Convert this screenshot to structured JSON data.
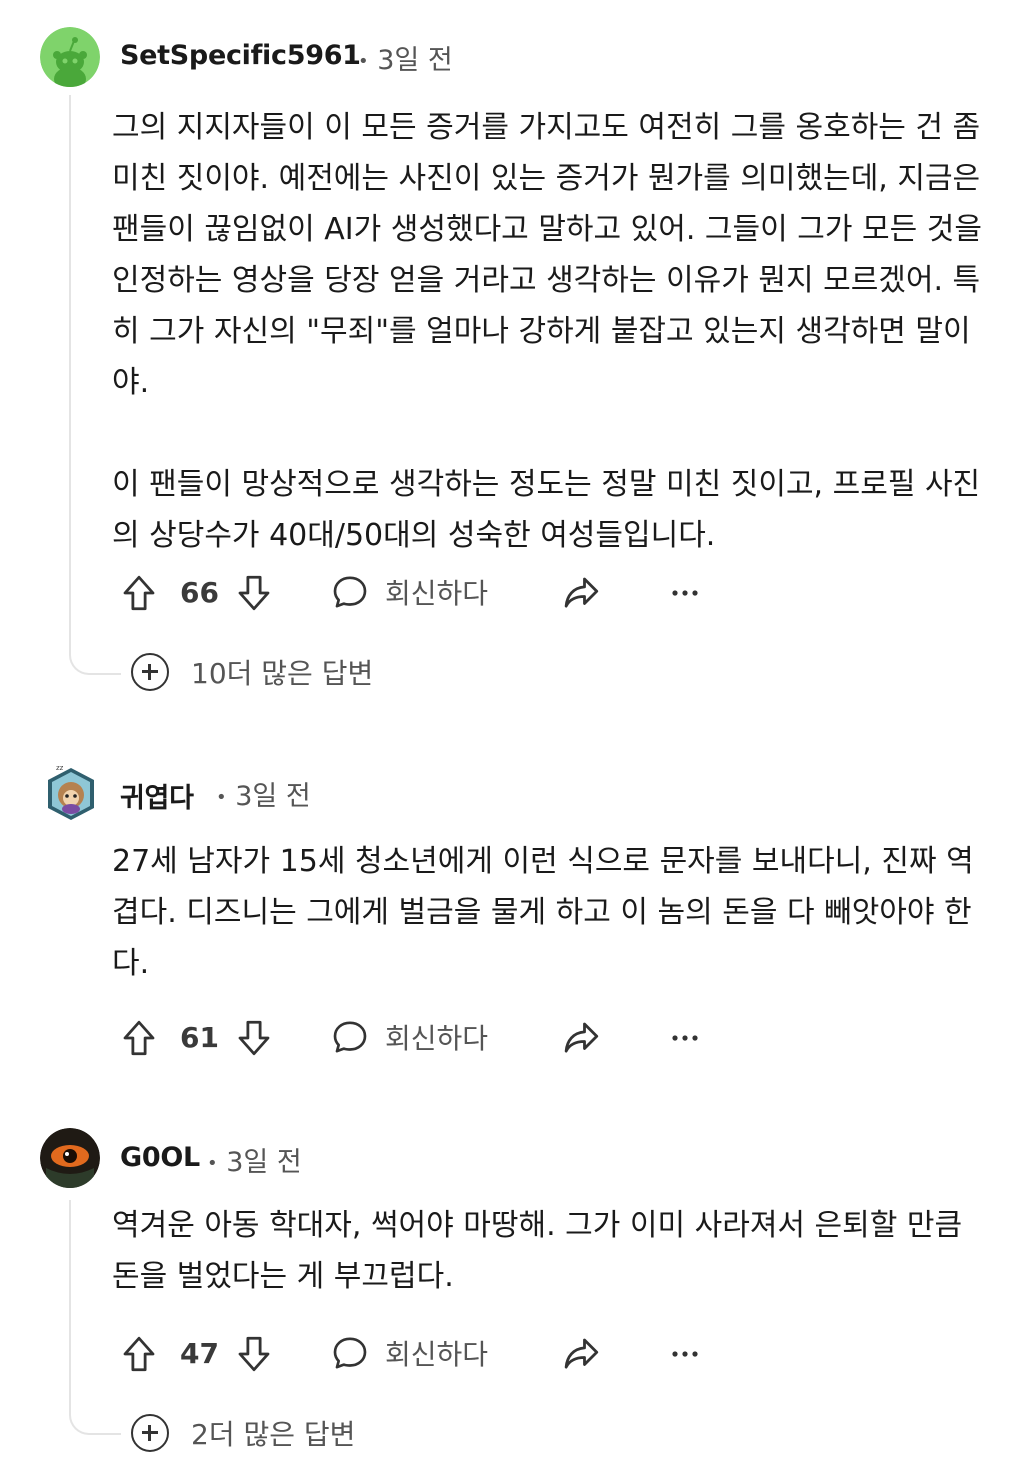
{
  "comments": [
    {
      "username": "SetSpecific5961",
      "time": "3일 전",
      "avatar_color": "#7fd36b",
      "paragraphs": [
        "그의 지지자들이 이 모든 증거를 가지고도 여전히 그를 옹호하는 건 좀 미친 짓이야. 예전에는 사진이 있는 증거가 뭔가를 의미했는데, 지금은 팬들이 끊임없이 AI가 생성했다고 말하고 있어. 그들이 그가 모든 것을 인정하는 영상을 당장 얻을 거라고 생각하는 이유가 뭔지 모르겠어. 특히 그가 자신의 \"무죄\"를 얼마나 강하게 붙잡고 있는지 생각하면 말이야.",
        "이 팬들이 망상적으로 생각하는 정도는 정말 미친 짓이고, 프로필 사진의 상당수가 40대/50대의 성숙한 여성들입니다."
      ],
      "votes": "66",
      "reply_label": "회신하다",
      "more_replies": "10더 많은 답변"
    },
    {
      "username": "귀엽다",
      "time": "3일 전",
      "paragraphs": [
        "27세 남자가 15세 청소년에게 이런 식으로 문자를 보내다니, 진짜 역겹다. 디즈니는 그에게 벌금을 물게 하고 이 놈의 돈을 다 빼앗아야 한다."
      ],
      "votes": "61",
      "reply_label": "회신하다"
    },
    {
      "username": "G0OL",
      "time": "3일 전",
      "paragraphs": [
        "역겨운 아동 학대자, 썩어야 마땅해. 그가 이미 사라져서 은퇴할 만큼 돈을 벌었다는 게 부끄럽다."
      ],
      "votes": "47",
      "reply_label": "회신하다",
      "more_replies": "2더 많은 답변"
    }
  ],
  "meta_separator": "•"
}
